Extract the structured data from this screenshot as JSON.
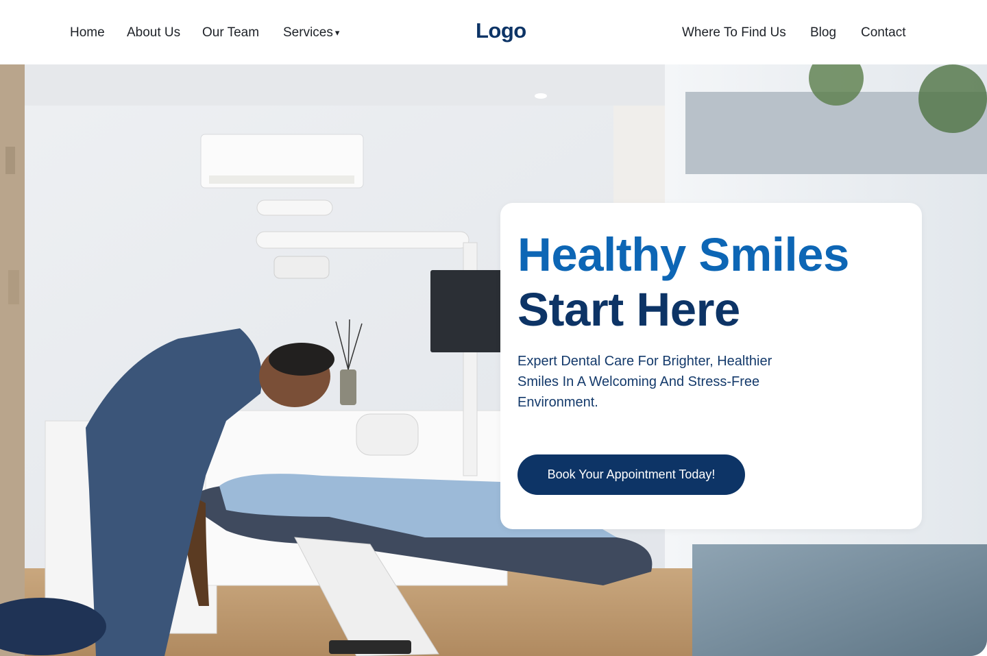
{
  "nav": {
    "left_links": [
      {
        "label": "Home"
      },
      {
        "label": "About Us"
      },
      {
        "label": "Our Team"
      },
      {
        "label": "Services",
        "caret": "▾"
      }
    ],
    "logo": "Logo",
    "right_links": [
      {
        "label": "Where To Find Us"
      },
      {
        "label": "Blog"
      },
      {
        "label": "Contact"
      }
    ]
  },
  "hero": {
    "image_alt": "Dentist examining a patient in a dental chair",
    "headline_line1": "Healthy Smiles",
    "headline_line2": "Start Here",
    "subtext": "Expert Dental Care For Brighter, Healthier Smiles In A Welcoming And Stress-Free Environment.",
    "cta_label": "Book Your Appointment Today!"
  },
  "colors": {
    "primary_dark": "#0d3466",
    "primary_blue": "#0d66b5",
    "text": "#1d2127",
    "card_bg": "#ffffff"
  }
}
